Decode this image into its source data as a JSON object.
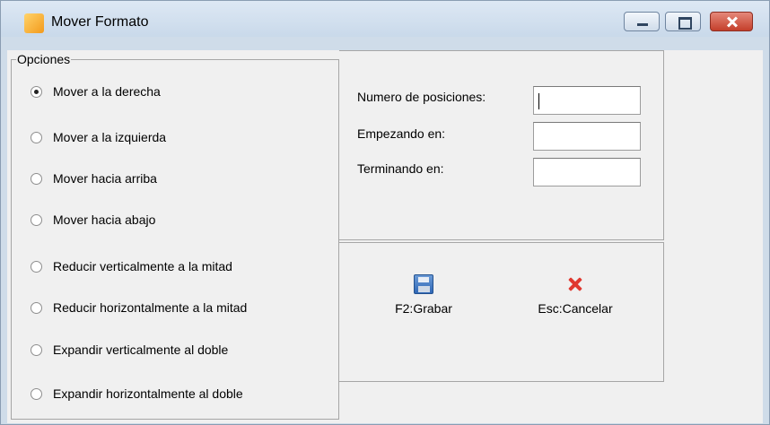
{
  "window": {
    "title": "Mover Formato"
  },
  "opciones": {
    "legend": "Opciones",
    "items": [
      {
        "label": "Mover a la derecha",
        "checked": true
      },
      {
        "label": "Mover a la izquierda",
        "checked": false
      },
      {
        "label": "Mover hacia arriba",
        "checked": false
      },
      {
        "label": "Mover hacia abajo",
        "checked": false
      },
      {
        "label": "Reducir verticalmente a la mitad",
        "checked": false
      },
      {
        "label": "Reducir horizontalmente a la mitad",
        "checked": false
      },
      {
        "label": "Expandir verticalmente al doble",
        "checked": false
      },
      {
        "label": "Expandir horizontalmente al doble",
        "checked": false
      }
    ]
  },
  "fields": {
    "posiciones_label": "Numero de posiciones:",
    "posiciones_value": "",
    "empezando_label": "Empezando en:",
    "empezando_value": "",
    "terminando_label": "Terminando en:",
    "terminando_value": ""
  },
  "actions": {
    "grabar_label": "F2:Grabar",
    "grabar_icon": "save-icon",
    "cancelar_label": "Esc:Cancelar",
    "cancelar_icon": "cancel-icon"
  }
}
